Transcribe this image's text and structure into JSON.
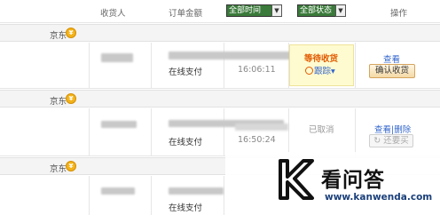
{
  "header": {
    "receiver": "收货人",
    "amount": "订单金额",
    "time_filter": "全部时间",
    "status_filter": "全部状态",
    "action": "操作"
  },
  "orders": [
    {
      "shop": "京东",
      "payment": "在线支付",
      "time": "16:06:11",
      "status": "等待收货",
      "trace": "跟踪",
      "view": "查看",
      "confirm": "确认收货"
    },
    {
      "shop": "京东",
      "payment": "在线支付",
      "time": "16:50:24",
      "status": "已取消",
      "view_delete": "查看|删除",
      "rebuy": "还要买"
    },
    {
      "shop": "京东",
      "payment": "在线支付"
    }
  ],
  "watermark": {
    "title": "看问答",
    "url": "www.kanwenda.com"
  },
  "colors": {
    "accent_orange": "#e05a00",
    "link_blue": "#3366cc",
    "status_bg": "#fffbd0"
  },
  "icons": {
    "shop_tag": "jd-coin-icon",
    "dropdown": "chevron-down-icon"
  }
}
